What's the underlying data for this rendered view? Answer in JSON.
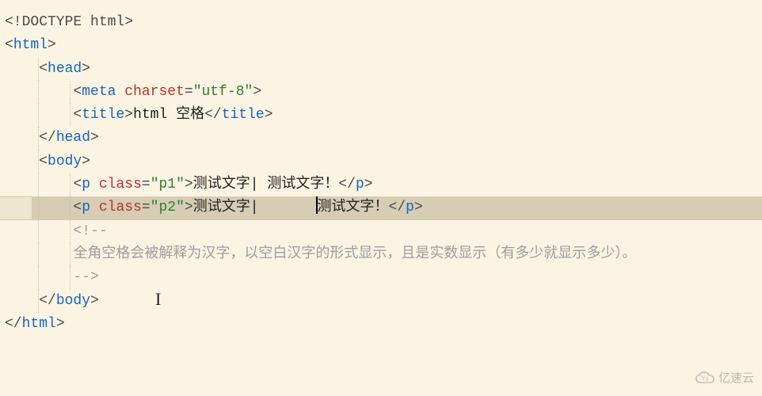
{
  "code": {
    "l1": {
      "doctype": "<!DOCTYPE html>"
    },
    "l2": {
      "open": "<",
      "tag": "html",
      "close": ">"
    },
    "l3": {
      "open": "<",
      "tag": "head",
      "close": ">"
    },
    "l4": {
      "open": "<",
      "tag": "meta",
      "sp": " ",
      "attr": "charset",
      "eq": "=",
      "val": "\"utf-8\"",
      "close": ">"
    },
    "l5": {
      "open": "<",
      "tag": "title",
      "close1": ">",
      "text": "html 空格",
      "open2": "</",
      "close2": ">"
    },
    "l6": {
      "open": "</",
      "tag": "head",
      "close": ">"
    },
    "l7": {
      "open": "<",
      "tag": "body",
      "close": ">"
    },
    "l8": {
      "open": "<",
      "tag": "p",
      "sp": " ",
      "attr": "class",
      "eq": "=",
      "val": "\"p1\"",
      "close1": ">",
      "text": "测试文字| 测试文字！",
      "open2": "</",
      "close2": ">"
    },
    "l9": {
      "open": "<",
      "tag": "p",
      "sp": " ",
      "attr": "class",
      "eq": "=",
      "val": "\"p2\"",
      "close1": ">",
      "textA": "测试文字|　　　　",
      "textB": "测试文字！",
      "open2": "</",
      "close2": ">"
    },
    "l10": {
      "comment_open": "<!--"
    },
    "l11": {
      "comment_text": "全角空格会被解释为汉字，以空白汉字的形式显示，且是实数显示（有多少就显示多少）。"
    },
    "l12": {
      "comment_close": "-->"
    },
    "l13": {
      "open": "</",
      "tag": "body",
      "close": ">"
    },
    "l14": {
      "open": "</",
      "tag": "html",
      "close": ">"
    }
  },
  "indent": {
    "i1": "    ",
    "i2": "        "
  },
  "watermark": {
    "text": "亿速云"
  }
}
